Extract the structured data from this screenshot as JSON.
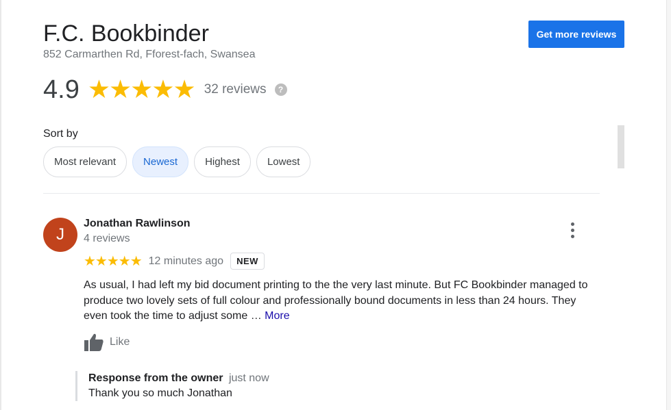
{
  "business": {
    "name": "F.C. Bookbinder",
    "address": "852 Carmarthen Rd, Fforest-fach, Swansea",
    "get_more_label": "Get more reviews"
  },
  "rating": {
    "score": "4.9",
    "stars_glyph": "★★★★★",
    "stars_shown": 5,
    "review_count": "32 reviews",
    "help_glyph": "?"
  },
  "sort": {
    "label": "Sort by",
    "options": [
      "Most relevant",
      "Newest",
      "Highest",
      "Lowest"
    ],
    "selected": "Newest"
  },
  "review": {
    "avatar_letter": "J",
    "avatar_color": "#c1431c",
    "reviewer": "Jonathan Rawlinson",
    "reviewer_reviews": "4 reviews",
    "stars_glyph": "★★★★★",
    "stars_shown": 5,
    "time": "12 minutes ago",
    "badge": "NEW",
    "text": "As usual, I had left my bid document printing to the the very last minute. But FC Bookbinder managed to produce two lovely sets of full colour and professionally bound documents in less than 24 hours. They even took the time to adjust some … ",
    "more_label": "More",
    "like_label": "Like"
  },
  "owner_response": {
    "title": "Response from the owner",
    "time": "just now",
    "text": "Thank you so much Jonathan"
  },
  "colors": {
    "accent": "#1a73e8",
    "star": "#fbbc04",
    "chip_active_bg": "#e8f0fe",
    "chip_active_text": "#1967d2"
  },
  "icons": {
    "help": "help-icon",
    "more_options": "more-vert-icon",
    "like": "thumbs-up-icon"
  }
}
